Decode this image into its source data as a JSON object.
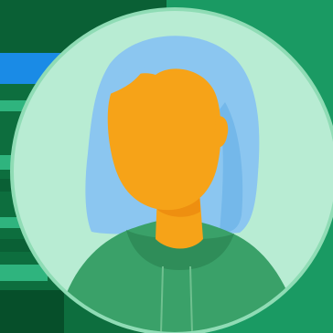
{
  "image": {
    "subject": "default-avatar-illustration"
  },
  "colors": {
    "background_dark_green": "#0d6e3e",
    "background_right_green": "#1a9a63",
    "stripe_blue": "#1a8be6",
    "stripe_mint": "#2fb47e",
    "stripe_deep": "#064f2a",
    "circle_fill": "#b8ecd3",
    "circle_border": "#8fdcb5",
    "hair": "#8bc6f0",
    "hair_shadow": "#6cb2e6",
    "face": "#f6a318",
    "face_shadow": "#ee8f10",
    "hoodie": "#3aa169",
    "hoodie_dark": "#2f8d59",
    "hoodie_lines": "#6fc08f"
  }
}
